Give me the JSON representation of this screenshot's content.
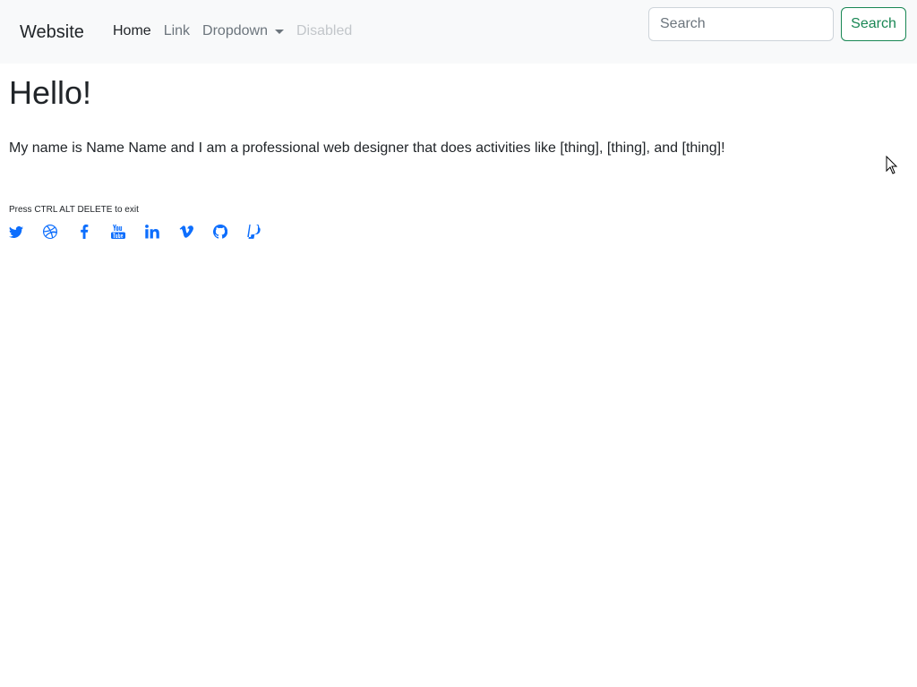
{
  "navbar": {
    "brand": "Website",
    "links": [
      {
        "label": "Home",
        "state": "active"
      },
      {
        "label": "Link",
        "state": "normal"
      },
      {
        "label": "Dropdown",
        "state": "dropdown"
      },
      {
        "label": "Disabled",
        "state": "disabled"
      }
    ],
    "search": {
      "placeholder": "Search",
      "value": ""
    },
    "search_button": "Search"
  },
  "main": {
    "title": "Hello!",
    "intro": "My name is Name Name and I am a professional web designer that does activities like [thing], [thing], and [thing]!",
    "note": "Press CTRL ALT DELETE to exit",
    "social_icons": [
      "twitter-icon",
      "dribbble-icon",
      "facebook-icon",
      "youtube-icon",
      "linkedin-icon",
      "vimeo-icon",
      "github-icon",
      "paypal-icon"
    ]
  },
  "colors": {
    "navbar_bg": "#f8f9fa",
    "link_muted": "#6c757d",
    "link_disabled": "#c2c6ca",
    "success": "#198754",
    "icon_blue": "#0d6efd"
  }
}
